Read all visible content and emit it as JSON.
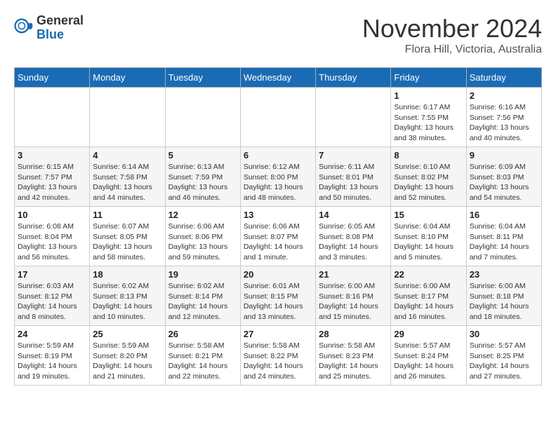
{
  "header": {
    "logo_general": "General",
    "logo_blue": "Blue",
    "month_title": "November 2024",
    "location": "Flora Hill, Victoria, Australia"
  },
  "days_of_week": [
    "Sunday",
    "Monday",
    "Tuesday",
    "Wednesday",
    "Thursday",
    "Friday",
    "Saturday"
  ],
  "weeks": [
    [
      {
        "day": "",
        "info": ""
      },
      {
        "day": "",
        "info": ""
      },
      {
        "day": "",
        "info": ""
      },
      {
        "day": "",
        "info": ""
      },
      {
        "day": "",
        "info": ""
      },
      {
        "day": "1",
        "info": "Sunrise: 6:17 AM\nSunset: 7:55 PM\nDaylight: 13 hours\nand 38 minutes."
      },
      {
        "day": "2",
        "info": "Sunrise: 6:16 AM\nSunset: 7:56 PM\nDaylight: 13 hours\nand 40 minutes."
      }
    ],
    [
      {
        "day": "3",
        "info": "Sunrise: 6:15 AM\nSunset: 7:57 PM\nDaylight: 13 hours\nand 42 minutes."
      },
      {
        "day": "4",
        "info": "Sunrise: 6:14 AM\nSunset: 7:58 PM\nDaylight: 13 hours\nand 44 minutes."
      },
      {
        "day": "5",
        "info": "Sunrise: 6:13 AM\nSunset: 7:59 PM\nDaylight: 13 hours\nand 46 minutes."
      },
      {
        "day": "6",
        "info": "Sunrise: 6:12 AM\nSunset: 8:00 PM\nDaylight: 13 hours\nand 48 minutes."
      },
      {
        "day": "7",
        "info": "Sunrise: 6:11 AM\nSunset: 8:01 PM\nDaylight: 13 hours\nand 50 minutes."
      },
      {
        "day": "8",
        "info": "Sunrise: 6:10 AM\nSunset: 8:02 PM\nDaylight: 13 hours\nand 52 minutes."
      },
      {
        "day": "9",
        "info": "Sunrise: 6:09 AM\nSunset: 8:03 PM\nDaylight: 13 hours\nand 54 minutes."
      }
    ],
    [
      {
        "day": "10",
        "info": "Sunrise: 6:08 AM\nSunset: 8:04 PM\nDaylight: 13 hours\nand 56 minutes."
      },
      {
        "day": "11",
        "info": "Sunrise: 6:07 AM\nSunset: 8:05 PM\nDaylight: 13 hours\nand 58 minutes."
      },
      {
        "day": "12",
        "info": "Sunrise: 6:06 AM\nSunset: 8:06 PM\nDaylight: 13 hours\nand 59 minutes."
      },
      {
        "day": "13",
        "info": "Sunrise: 6:06 AM\nSunset: 8:07 PM\nDaylight: 14 hours\nand 1 minute."
      },
      {
        "day": "14",
        "info": "Sunrise: 6:05 AM\nSunset: 8:08 PM\nDaylight: 14 hours\nand 3 minutes."
      },
      {
        "day": "15",
        "info": "Sunrise: 6:04 AM\nSunset: 8:10 PM\nDaylight: 14 hours\nand 5 minutes."
      },
      {
        "day": "16",
        "info": "Sunrise: 6:04 AM\nSunset: 8:11 PM\nDaylight: 14 hours\nand 7 minutes."
      }
    ],
    [
      {
        "day": "17",
        "info": "Sunrise: 6:03 AM\nSunset: 8:12 PM\nDaylight: 14 hours\nand 8 minutes."
      },
      {
        "day": "18",
        "info": "Sunrise: 6:02 AM\nSunset: 8:13 PM\nDaylight: 14 hours\nand 10 minutes."
      },
      {
        "day": "19",
        "info": "Sunrise: 6:02 AM\nSunset: 8:14 PM\nDaylight: 14 hours\nand 12 minutes."
      },
      {
        "day": "20",
        "info": "Sunrise: 6:01 AM\nSunset: 8:15 PM\nDaylight: 14 hours\nand 13 minutes."
      },
      {
        "day": "21",
        "info": "Sunrise: 6:00 AM\nSunset: 8:16 PM\nDaylight: 14 hours\nand 15 minutes."
      },
      {
        "day": "22",
        "info": "Sunrise: 6:00 AM\nSunset: 8:17 PM\nDaylight: 14 hours\nand 16 minutes."
      },
      {
        "day": "23",
        "info": "Sunrise: 6:00 AM\nSunset: 8:18 PM\nDaylight: 14 hours\nand 18 minutes."
      }
    ],
    [
      {
        "day": "24",
        "info": "Sunrise: 5:59 AM\nSunset: 8:19 PM\nDaylight: 14 hours\nand 19 minutes."
      },
      {
        "day": "25",
        "info": "Sunrise: 5:59 AM\nSunset: 8:20 PM\nDaylight: 14 hours\nand 21 minutes."
      },
      {
        "day": "26",
        "info": "Sunrise: 5:58 AM\nSunset: 8:21 PM\nDaylight: 14 hours\nand 22 minutes."
      },
      {
        "day": "27",
        "info": "Sunrise: 5:58 AM\nSunset: 8:22 PM\nDaylight: 14 hours\nand 24 minutes."
      },
      {
        "day": "28",
        "info": "Sunrise: 5:58 AM\nSunset: 8:23 PM\nDaylight: 14 hours\nand 25 minutes."
      },
      {
        "day": "29",
        "info": "Sunrise: 5:57 AM\nSunset: 8:24 PM\nDaylight: 14 hours\nand 26 minutes."
      },
      {
        "day": "30",
        "info": "Sunrise: 5:57 AM\nSunset: 8:25 PM\nDaylight: 14 hours\nand 27 minutes."
      }
    ]
  ]
}
